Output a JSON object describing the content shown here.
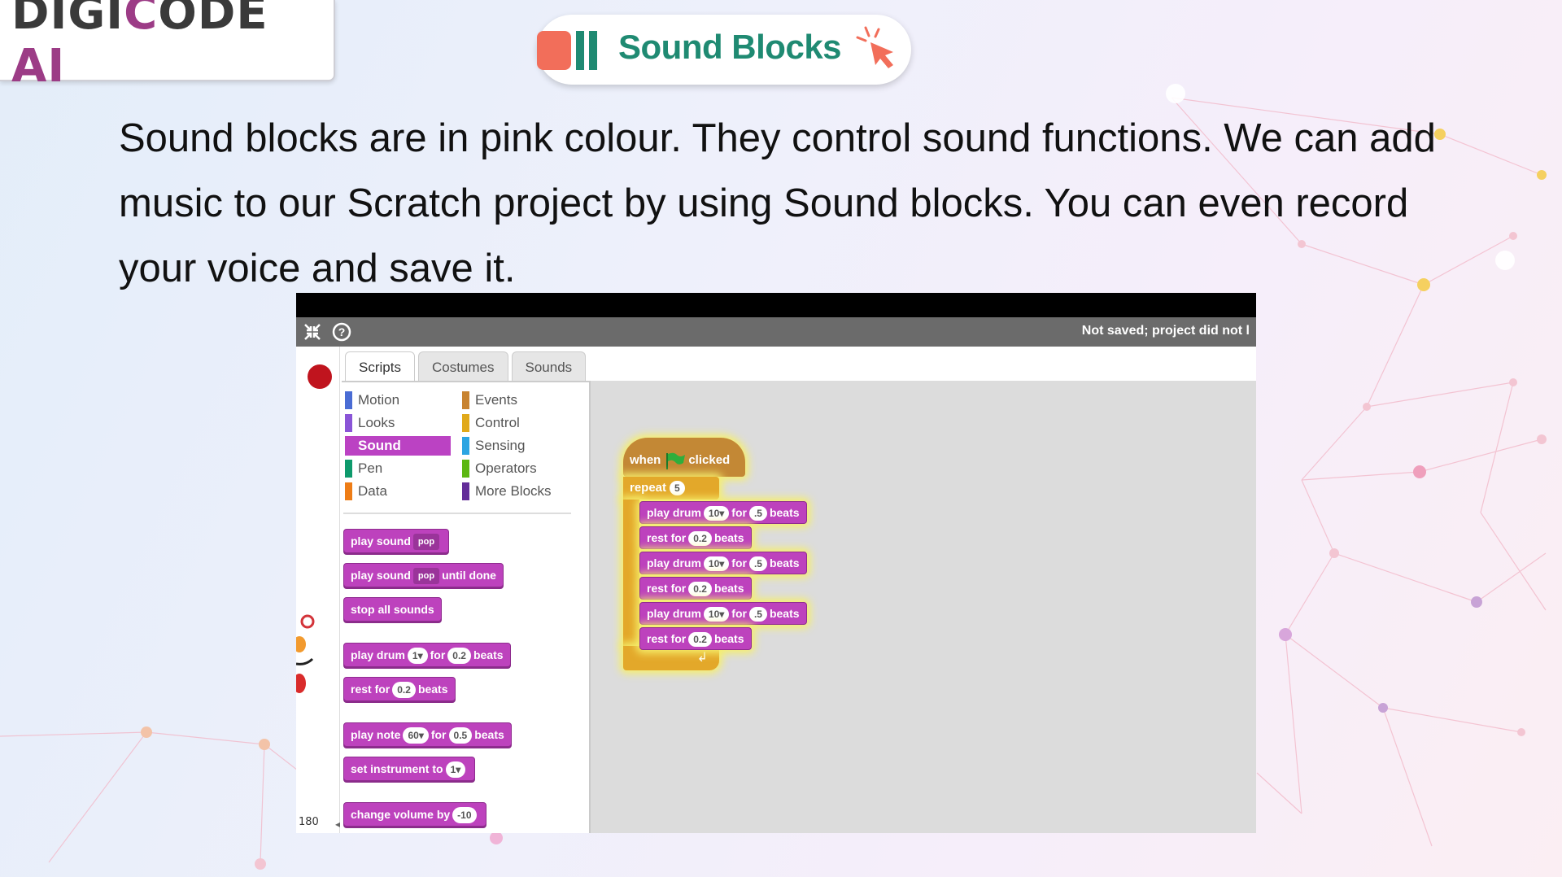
{
  "logo": {
    "text_prefix": "DIGI",
    "text_c": "C",
    "text_ode": "ODE ",
    "text_ai": "AI"
  },
  "title": "Sound Blocks",
  "paragraph": "Sound blocks are in pink colour. They control sound functions. We can add music to our Scratch project by using Sound blocks. You can even record your voice and save it.",
  "colors": {
    "brand_purple": "#9c3c86",
    "title_green": "#1f8a72",
    "sound_pink": "#bd42bd",
    "events_brown": "#c38835",
    "control_yellow": "#e3a82a"
  },
  "scratch": {
    "status": "Not saved; project did not l",
    "coordinate": "180",
    "tabs": [
      {
        "label": "Scripts"
      },
      {
        "label": "Costumes"
      },
      {
        "label": "Sounds"
      }
    ],
    "categories_left": [
      {
        "label": "Motion",
        "color": "#4a6cd4"
      },
      {
        "label": "Looks",
        "color": "#8a55d7"
      },
      {
        "label": "Sound",
        "color": "#bb42c3"
      },
      {
        "label": "Pen",
        "color": "#0e9a6c"
      },
      {
        "label": "Data",
        "color": "#ee7d16"
      }
    ],
    "categories_right": [
      {
        "label": "Events",
        "color": "#c88330"
      },
      {
        "label": "Control",
        "color": "#e1a91a"
      },
      {
        "label": "Sensing",
        "color": "#2ca5e2"
      },
      {
        "label": "Operators",
        "color": "#5cb712"
      },
      {
        "label": "More Blocks",
        "color": "#632d99"
      }
    ],
    "palette_blocks": {
      "play_sound": {
        "a": "play",
        "b": "sound",
        "v": "pop"
      },
      "play_sound_until": {
        "a": "play",
        "b": "sound",
        "v": "pop",
        "c": "until",
        "d": "done"
      },
      "stop_all": {
        "a": "stop",
        "b": "all",
        "c": "sounds"
      },
      "play_drum": {
        "a": "play",
        "b": "drum",
        "v": "1▾",
        "c": "for",
        "v2": "0.2",
        "d": "beats"
      },
      "rest": {
        "a": "rest",
        "b": "for",
        "v": "0.2",
        "c": "beats"
      },
      "play_note": {
        "a": "play",
        "b": "note",
        "v": "60▾",
        "c": "for",
        "v2": "0.5",
        "d": "beats"
      },
      "set_instrument": {
        "a": "set",
        "b": "instrument",
        "c": "to",
        "v": "1▾"
      },
      "change_volume": {
        "a": "change",
        "b": "volume",
        "c": "by",
        "v": "-10"
      }
    },
    "script": {
      "hat_when": "when",
      "hat_clicked": "clicked",
      "repeat_label": "repeat",
      "repeat_value": "5",
      "loop_arrow": "↲",
      "drum_a": "play",
      "drum_b": "drum",
      "drum_v": "10▾",
      "drum_c": "for",
      "drum_v2": ".5",
      "drum_d": "beats",
      "rest_a": "rest",
      "rest_b": "for",
      "rest_v": "0.2",
      "rest_c": "beats"
    }
  }
}
